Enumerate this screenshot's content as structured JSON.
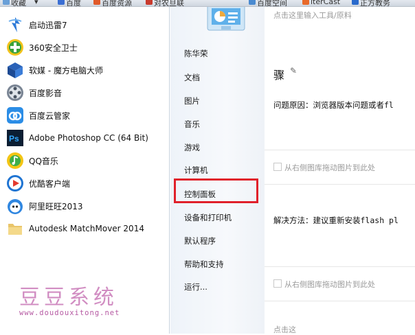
{
  "bookmarks_bar": {
    "items": [
      "收藏",
      "百度",
      "百度资源",
      "对农旦联",
      "百度空间",
      "iterCast",
      "正方教务"
    ]
  },
  "start_menu": {
    "programs": [
      {
        "label": "启动迅雷7",
        "icon": "thunder-icon"
      },
      {
        "label": "360安全卫士",
        "icon": "360-safeguard-icon"
      },
      {
        "label": "软媒 - 魔方电脑大师",
        "icon": "rubik-cube-icon"
      },
      {
        "label": "百度影音",
        "icon": "baidu-player-icon"
      },
      {
        "label": "百度云管家",
        "icon": "baidu-cloud-icon"
      },
      {
        "label": "Adobe Photoshop CC (64 Bit)",
        "icon": "photoshop-icon"
      },
      {
        "label": "QQ音乐",
        "icon": "qq-music-icon"
      },
      {
        "label": "优酷客户端",
        "icon": "youku-icon"
      },
      {
        "label": "阿里旺旺2013",
        "icon": "aliwangwang-icon"
      },
      {
        "label": "Autodesk MatchMover 2014",
        "icon": "folder-icon"
      }
    ],
    "right_items": [
      "陈华荣",
      "文档",
      "图片",
      "音乐",
      "游戏",
      "计算机",
      "控制面板",
      "设备和打印机",
      "默认程序",
      "帮助和支持",
      "运行..."
    ],
    "highlighted_item": "控制面板",
    "highlight_color": "#e0202a"
  },
  "background_page": {
    "top_fragment": "点击这里输入工具/原料",
    "heading_fragment": "骤",
    "step1": "问题原因：浏览器版本问题或者fl",
    "placeholder1": "从右侧图库拖动图片到此处",
    "step2": "解决方法：建议重新安装flash pl",
    "placeholder2": "从右侧图库拖动图片到此处",
    "bottom_fragment": "点击这"
  },
  "watermark": {
    "title": "豆豆系统",
    "url": "www.doudouxitong.net"
  }
}
